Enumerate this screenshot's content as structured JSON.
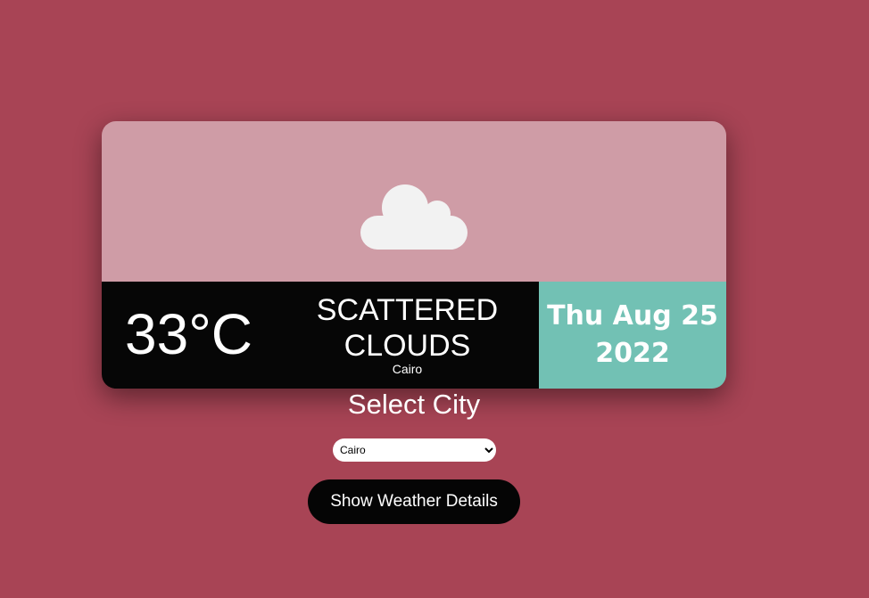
{
  "weather": {
    "icon": "cloud-icon",
    "temperature": "33°C",
    "condition": "SCATTERED CLOUDS",
    "city": "Cairo",
    "date_line1": "Thu Aug 25",
    "date_line2": "2022"
  },
  "controls": {
    "select_title": "Select City",
    "selected_city": "Cairo",
    "button_label": "Show Weather Details"
  },
  "colors": {
    "background": "#a84455",
    "card_top": "#cf9ca6",
    "card_bottom": "#060606",
    "date_panel": "#72c1b4"
  }
}
